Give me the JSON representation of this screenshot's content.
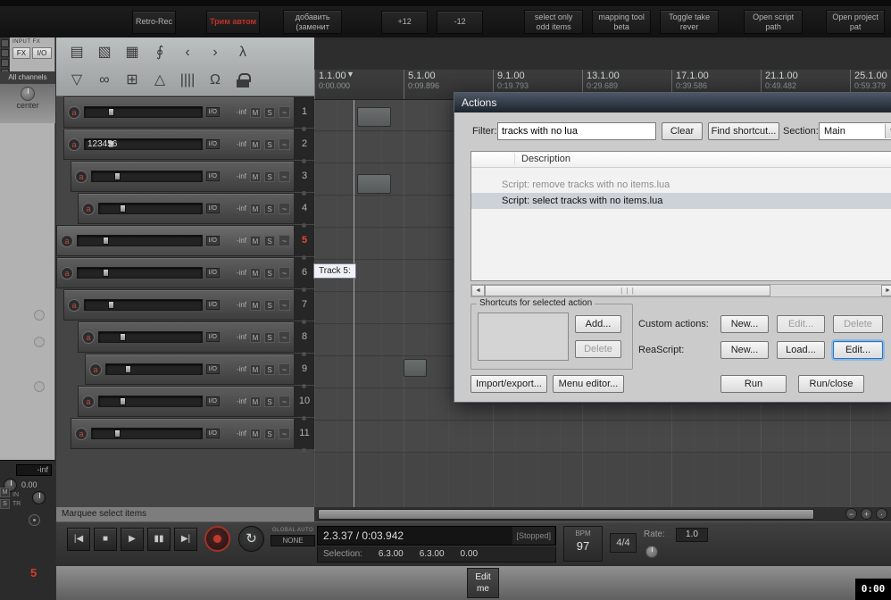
{
  "toolbar": {
    "buttons": [
      {
        "label": "Retro-Rec",
        "accent": false
      },
      {
        "label": "Трим автом",
        "accent": true
      },
      {
        "label": "добавить (заменит",
        "accent": false
      },
      {
        "label": "+12",
        "accent": false
      },
      {
        "label": "-12",
        "accent": false
      },
      {
        "label": "select only odd items",
        "accent": false
      },
      {
        "label": "mapping tool beta",
        "accent": false
      },
      {
        "label": "Toggle take rever",
        "accent": false
      },
      {
        "label": "Open script path",
        "accent": false
      },
      {
        "label": "Open project pat",
        "accent": false
      }
    ]
  },
  "left_rail": {
    "input_fx_label": "INPUT FX",
    "fx_button": "FX",
    "io_button": "I/O",
    "all_channels": "All channels",
    "center_label": "center",
    "master_volume": "-inf",
    "master_pan": "0.00",
    "mute": "M",
    "solo": "S",
    "in_label": "IN",
    "tr_label": "TR",
    "selected_track_number": "5"
  },
  "tcp_toolbar": {
    "row1": [
      {
        "name": "new-project-icon",
        "glyph": "▤"
      },
      {
        "name": "open-project-icon",
        "glyph": "▧"
      },
      {
        "name": "save-project-icon",
        "glyph": "▦"
      },
      {
        "name": "paperclip-icon",
        "glyph": "∮"
      },
      {
        "name": "undo-icon",
        "glyph": "‹"
      },
      {
        "name": "redo-icon",
        "glyph": "›"
      },
      {
        "name": "metronome-icon",
        "glyph": "λ"
      }
    ],
    "row2": [
      {
        "name": "filter-icon",
        "glyph": "▽"
      },
      {
        "name": "link-icon",
        "glyph": "∞"
      },
      {
        "name": "grid-icon",
        "glyph": "⊞"
      },
      {
        "name": "envelope-icon",
        "glyph": "△"
      },
      {
        "name": "grouping-icon",
        "glyph": "||||"
      },
      {
        "name": "snap-magnet-icon",
        "glyph": "Ω"
      },
      {
        "name": "lock-icon",
        "glyph": ""
      }
    ]
  },
  "ruler": {
    "marks": [
      {
        "bar": "1.1.00",
        "time": "0:00.000"
      },
      {
        "bar": "5.1.00",
        "time": "0:09.896"
      },
      {
        "bar": "9.1.00",
        "time": "0:19.793"
      },
      {
        "bar": "13.1.00",
        "time": "0:29.689"
      },
      {
        "bar": "17.1.00",
        "time": "0:39.586"
      },
      {
        "bar": "21.1.00",
        "time": "0:49.482"
      },
      {
        "bar": "25.1.00",
        "time": "0:59.379"
      }
    ],
    "edit_marker_glyph": "▼"
  },
  "track_controls": {
    "arm": "a",
    "io": "I/O",
    "vol": "-inf",
    "mute": "M",
    "solo": "S",
    "env": "~"
  },
  "tracks": [
    {
      "num": "1",
      "name": "",
      "indent": 8,
      "selected": false
    },
    {
      "num": "2",
      "name": "123456",
      "indent": 8,
      "selected": false
    },
    {
      "num": "3",
      "name": "",
      "indent": 16,
      "selected": false
    },
    {
      "num": "4",
      "name": "",
      "indent": 24,
      "selected": false
    },
    {
      "num": "5",
      "name": "",
      "indent": 0,
      "selected": true
    },
    {
      "num": "6",
      "name": "",
      "indent": 0,
      "selected": false
    },
    {
      "num": "7",
      "name": "",
      "indent": 8,
      "selected": false
    },
    {
      "num": "8",
      "name": "",
      "indent": 24,
      "selected": false
    },
    {
      "num": "9",
      "name": "",
      "indent": 32,
      "selected": false
    },
    {
      "num": "10",
      "name": "",
      "indent": 24,
      "selected": false
    },
    {
      "num": "11",
      "name": "",
      "indent": 16,
      "selected": false
    }
  ],
  "tooltip": "Track 5:",
  "status_bar": "Marquee select items",
  "hscroll_zoom": [
    {
      "name": "zoom-out-icon",
      "glyph": "−"
    },
    {
      "name": "zoom-in-icon",
      "glyph": "+"
    },
    {
      "name": "scroll-mode-icon",
      "glyph": "·"
    }
  ],
  "actions_dialog": {
    "title": "Actions",
    "filter_label": "Filter:",
    "filter_value": "tracks with no lua",
    "clear_button": "Clear",
    "find_shortcut_button": "Find shortcut...",
    "section_label": "Section:",
    "section_value": "Main",
    "list_header": "Description",
    "rows": [
      {
        "text": "Script: remove tracks with no items.lua",
        "selected": false
      },
      {
        "text": "Script: select tracks with no items.lua",
        "selected": true
      }
    ],
    "shortcuts_group_label": "Shortcuts for selected action",
    "add_button": "Add...",
    "delete_button": "Delete",
    "custom_actions_label": "Custom actions:",
    "custom_new": "New...",
    "custom_edit": "Edit...",
    "custom_delete": "Delete",
    "reascript_label": "ReaScript:",
    "rs_new": "New...",
    "rs_load": "Load...",
    "rs_edit": "Edit...",
    "import_export_button": "Import/export...",
    "menu_editor_button": "Menu editor...",
    "run_button": "Run",
    "run_close_button": "Run/close",
    "hscroll_grip": "| | |"
  },
  "transport": {
    "buttons": [
      {
        "name": "go-to-start-button",
        "glyph": "|◀"
      },
      {
        "name": "stop-button",
        "glyph": "■"
      },
      {
        "name": "play-button",
        "glyph": "▶"
      },
      {
        "name": "pause-button",
        "glyph": "▮▮"
      },
      {
        "name": "go-to-end-button",
        "glyph": "▶|"
      }
    ],
    "repeat_glyph": "↻",
    "global_auto_label": "GLOBAL AUTO",
    "auto_mode": "NONE",
    "position": "2.3.37 / 0:03.942",
    "status": "[Stopped]",
    "selection_label": "Selection:",
    "sel_start": "6.3.00",
    "sel_end": "6.3.00",
    "sel_length": "0.00",
    "bpm_label": "BPM",
    "bpm_value": "97",
    "time_signature": "4/4",
    "rate_label": "Rate:",
    "rate_value": "1.0"
  },
  "bottom": {
    "edit_button_line1": "Edit",
    "edit_button_line2": "me",
    "timer": "0:00"
  }
}
